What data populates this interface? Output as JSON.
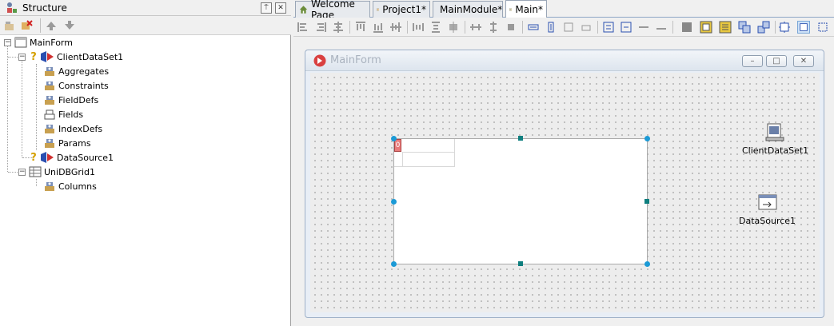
{
  "structure": {
    "title": "Structure",
    "pin_label": "⍑",
    "close_label": "✕",
    "tree": [
      {
        "label": "MainForm",
        "icon": "form-icon"
      },
      {
        "label": "ClientDataSet1",
        "icon": "dataset-icon",
        "warn": "?"
      },
      {
        "label": "Aggregates",
        "icon": "property-icon"
      },
      {
        "label": "Constraints",
        "icon": "property-icon"
      },
      {
        "label": "FieldDefs",
        "icon": "property-icon"
      },
      {
        "label": "Fields",
        "icon": "fields-icon"
      },
      {
        "label": "IndexDefs",
        "icon": "property-icon"
      },
      {
        "label": "Params",
        "icon": "property-icon"
      },
      {
        "label": "DataSource1",
        "icon": "datasource-icon",
        "warn": "?"
      },
      {
        "label": "UniDBGrid1",
        "icon": "grid-icon"
      },
      {
        "label": "Columns",
        "icon": "property-icon"
      }
    ]
  },
  "tabs": [
    {
      "label": "Welcome Page",
      "icon": "home-icon",
      "active": false
    },
    {
      "label": "Project1*",
      "icon": "project-icon",
      "active": false
    },
    {
      "label": "MainModule*",
      "icon": "module-icon",
      "active": false
    },
    {
      "label": "Main*",
      "icon": "unit-icon",
      "active": true
    }
  ],
  "form": {
    "caption": "MainForm",
    "min_label": "–",
    "max_label": "□",
    "close_label": "✕",
    "grid_marker": "0"
  },
  "components": [
    {
      "label": "ClientDataSet1",
      "icon": "clientdataset-icon"
    },
    {
      "label": "DataSource1",
      "icon": "datasource-icon"
    }
  ],
  "colors": {
    "accent": "#1b9ad6",
    "handle": "#0f7f7f",
    "warning": "#d4a000"
  }
}
